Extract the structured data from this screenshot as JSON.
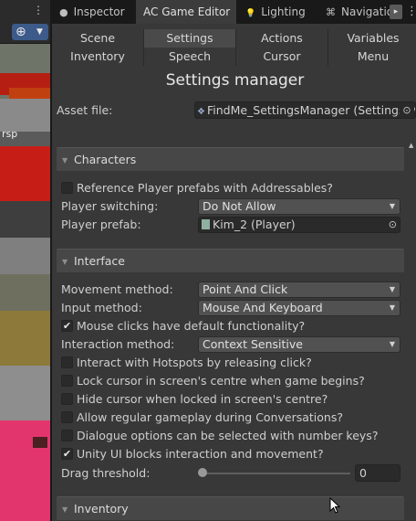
{
  "scene": {
    "menu_glyph": "⋮",
    "gizmo_glyph": "⊕",
    "gizmo_arrow": "▼",
    "label_fragment": "rsp"
  },
  "tabs": [
    {
      "label": "Inspector",
      "icon": "info-icon",
      "glyph": "●"
    },
    {
      "label": "AC Game Editor",
      "icon": "",
      "glyph": ""
    },
    {
      "label": "Lighting",
      "icon": "lightbulb-icon",
      "glyph": "💡"
    },
    {
      "label": "Navigatio",
      "icon": "navigation-icon",
      "glyph": "⌘"
    }
  ],
  "tab_more": "▸",
  "tab_kebab": "⋮",
  "nav": {
    "row1": [
      "Scene",
      "Settings",
      "Actions",
      "Variables"
    ],
    "row2": [
      "Inventory",
      "Speech",
      "Cursor",
      "Menu"
    ],
    "selected": "Settings"
  },
  "title": "Settings manager",
  "asset": {
    "label": "Asset file:",
    "value": "FindMe_SettingsManager (Settings M",
    "icon": "scriptable-object-icon",
    "pick_glyph": "⊙"
  },
  "sections": {
    "characters": "Characters",
    "interface": "Interface",
    "inventory": "Inventory"
  },
  "section_glyph": "▼",
  "characters": {
    "ref_prefabs": {
      "label": "Reference Player prefabs with Addressables?",
      "checked": false
    },
    "switching": {
      "label": "Player switching:",
      "value": "Do Not Allow"
    },
    "prefab": {
      "label": "Player prefab:",
      "value": "Kim_2 (Player)"
    }
  },
  "interface": {
    "movement": {
      "label": "Movement method:",
      "value": "Point And Click"
    },
    "input": {
      "label": "Input method:",
      "value": "Mouse And Keyboard"
    },
    "mouse_default": {
      "label": "Mouse clicks have default functionality?",
      "checked": true
    },
    "interaction": {
      "label": "Interaction method:",
      "value": "Context Sensitive"
    },
    "checkboxes": [
      {
        "label": "Interact with Hotspots by releasing click?",
        "checked": false
      },
      {
        "label": "Lock cursor in screen's centre when game begins?",
        "checked": false
      },
      {
        "label": "Hide cursor when locked in screen's centre?",
        "checked": false
      },
      {
        "label": "Allow regular gameplay during Conversations?",
        "checked": false
      },
      {
        "label": "Dialogue options can be selected with number keys?",
        "checked": false
      },
      {
        "label": "Unity UI blocks interaction and movement?",
        "checked": true
      }
    ],
    "drag": {
      "label": "Drag threshold:",
      "value": "0",
      "fraction": 0
    }
  },
  "glyphs": {
    "check": "✔",
    "dropdown": "▼",
    "pick": "⊙"
  }
}
